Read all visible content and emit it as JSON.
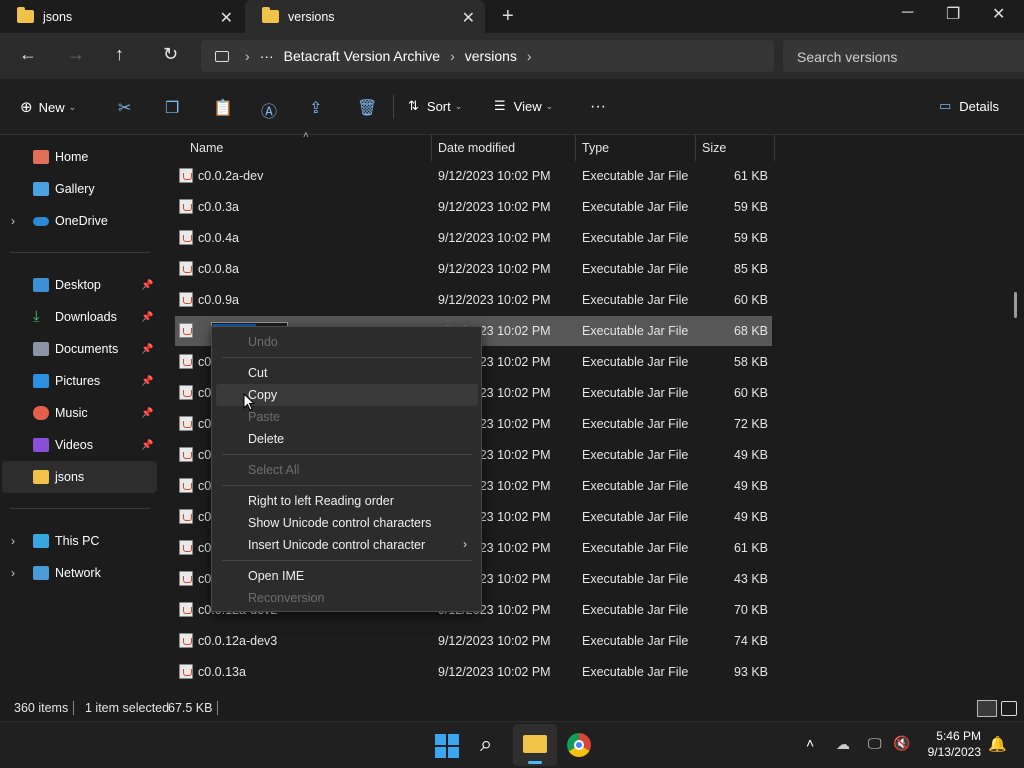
{
  "tabs": [
    {
      "label": "jsons",
      "active": false
    },
    {
      "label": "versions",
      "active": true
    }
  ],
  "window_controls": {
    "minimize": "─",
    "maximize": "❐",
    "close": "✕",
    "new_tab": "+"
  },
  "breadcrumb": {
    "more": "···",
    "items": [
      "Betacraft Version Archive",
      "versions"
    ]
  },
  "search": {
    "placeholder": "Search versions"
  },
  "toolbar": {
    "new": "New",
    "sort": "Sort",
    "view": "View",
    "more": "···",
    "details": "Details"
  },
  "sidebar": {
    "top": [
      {
        "label": "Home"
      },
      {
        "label": "Gallery"
      },
      {
        "label": "OneDrive"
      }
    ],
    "pinned": [
      {
        "label": "Desktop"
      },
      {
        "label": "Downloads"
      },
      {
        "label": "Documents"
      },
      {
        "label": "Pictures"
      },
      {
        "label": "Music"
      },
      {
        "label": "Videos"
      },
      {
        "label": "jsons"
      }
    ],
    "bottom": [
      {
        "label": "This PC"
      },
      {
        "label": "Network"
      }
    ]
  },
  "columns": {
    "name": "Name",
    "date": "Date modified",
    "type": "Type",
    "size": "Size"
  },
  "files": [
    {
      "name": "c0.0.2a-dev",
      "date": "9/12/2023 10:02 PM",
      "type": "Executable Jar File",
      "size": "61 KB"
    },
    {
      "name": "c0.0.3a",
      "date": "9/12/2023 10:02 PM",
      "type": "Executable Jar File",
      "size": "59 KB"
    },
    {
      "name": "c0.0.4a",
      "date": "9/12/2023 10:02 PM",
      "type": "Executable Jar File",
      "size": "59 KB"
    },
    {
      "name": "c0.0.8a",
      "date": "9/12/2023 10:02 PM",
      "type": "Executable Jar File",
      "size": "85 KB"
    },
    {
      "name": "c0.0.9a",
      "date": "9/12/2023 10:02 PM",
      "type": "Executable Jar File",
      "size": "60 KB"
    },
    {
      "name": "c0.0.10",
      "date": "9/12/2023 10:02 PM",
      "type": "Executable Jar File",
      "size": "68 KB",
      "selected": true
    },
    {
      "name": "c0",
      "date": "9/12/2023 10:02 PM",
      "type": "Executable Jar File",
      "size": "58 KB"
    },
    {
      "name": "c0",
      "date": "9/12/2023 10:02 PM",
      "type": "Executable Jar File",
      "size": "60 KB"
    },
    {
      "name": "c0",
      "date": "9/12/2023 10:02 PM",
      "type": "Executable Jar File",
      "size": "72 KB"
    },
    {
      "name": "c0",
      "date": "9/12/2023 10:02 PM",
      "type": "Executable Jar File",
      "size": "49 KB"
    },
    {
      "name": "c0",
      "date": "9/12/2023 10:02 PM",
      "type": "Executable Jar File",
      "size": "49 KB"
    },
    {
      "name": "c0",
      "date": "9/12/2023 10:02 PM",
      "type": "Executable Jar File",
      "size": "49 KB"
    },
    {
      "name": "c0",
      "date": "9/12/2023 10:02 PM",
      "type": "Executable Jar File",
      "size": "61 KB"
    },
    {
      "name": "c0",
      "date": "9/12/2023 10:02 PM",
      "type": "Executable Jar File",
      "size": "43 KB"
    },
    {
      "name": "c0.0.12a-dev2",
      "date": "9/12/2023 10:02 PM",
      "type": "Executable Jar File",
      "size": "70 KB"
    },
    {
      "name": "c0.0.12a-dev3",
      "date": "9/12/2023 10:02 PM",
      "type": "Executable Jar File",
      "size": "74 KB"
    },
    {
      "name": "c0.0.13a",
      "date": "9/12/2023 10:02 PM",
      "type": "Executable Jar File",
      "size": "93 KB"
    }
  ],
  "rename_text": "c0.0.10",
  "context_menu": {
    "undo": "Undo",
    "cut": "Cut",
    "copy": "Copy",
    "paste": "Paste",
    "delete": "Delete",
    "select_all": "Select All",
    "rtl": "Right to left Reading order",
    "show_unicode": "Show Unicode control characters",
    "insert_unicode": "Insert Unicode control character",
    "open_ime": "Open IME",
    "reconversion": "Reconversion"
  },
  "status": {
    "items": "360 items",
    "selected": "1 item selected",
    "size": "67.5 KB"
  },
  "taskbar": {
    "time": "5:46 PM",
    "date": "9/13/2023"
  },
  "colors": {
    "accent": "#0a5db8",
    "folder": "#f0c248"
  }
}
